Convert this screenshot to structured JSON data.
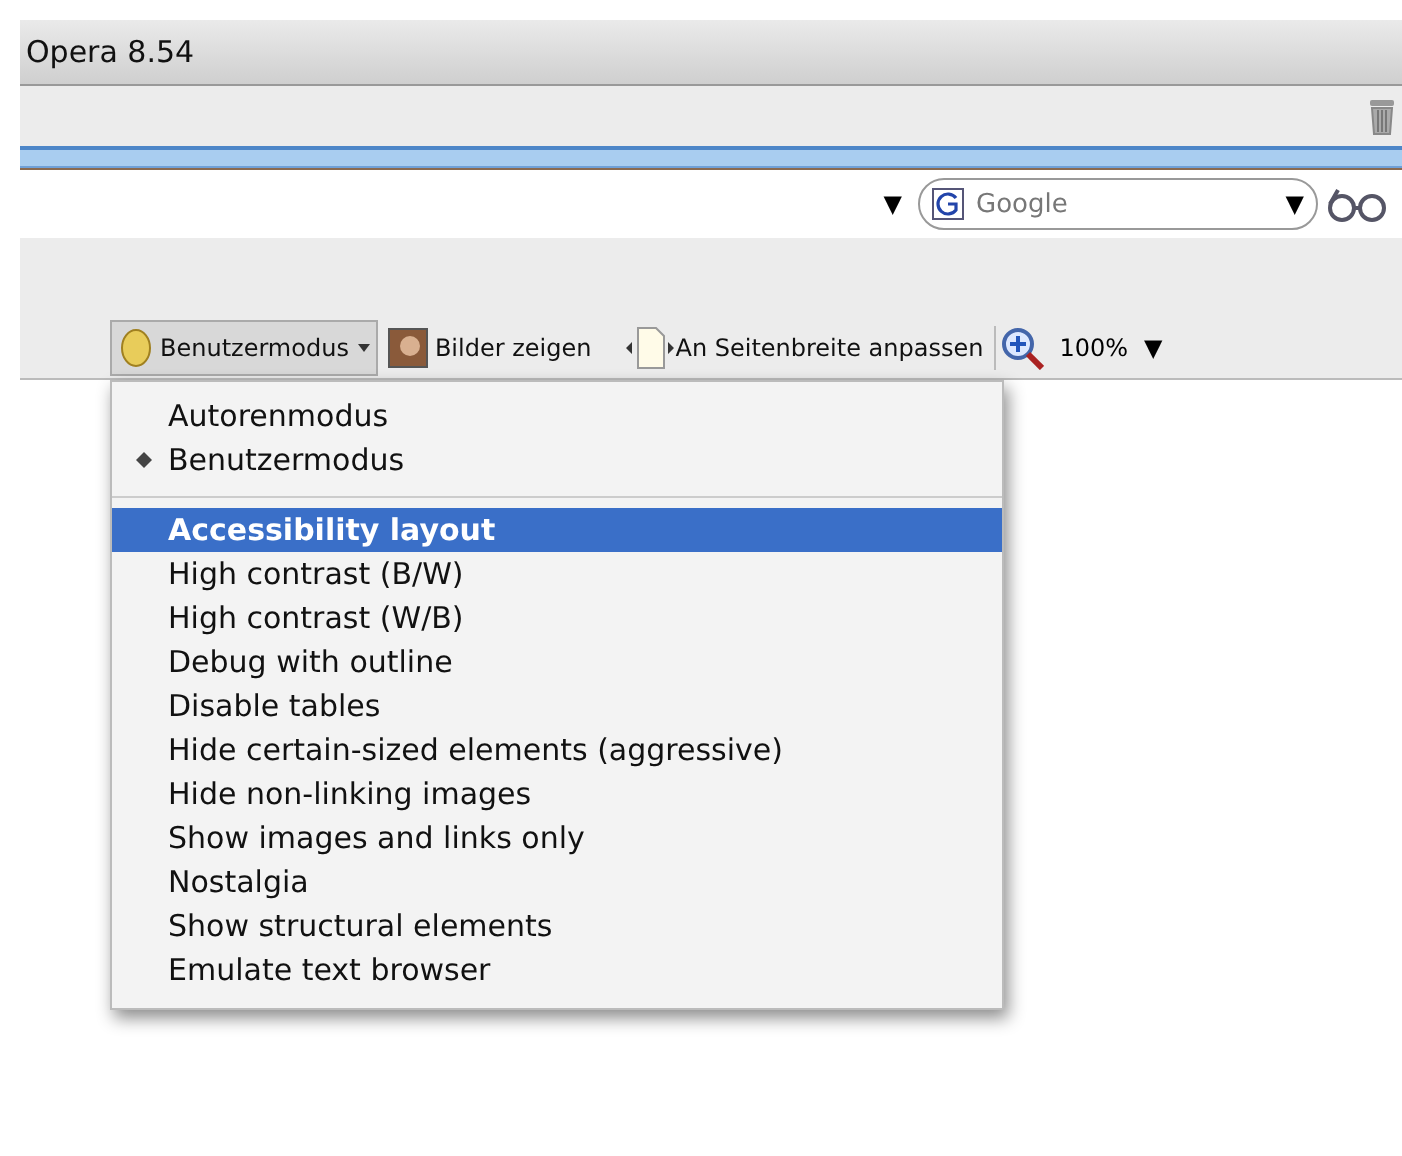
{
  "window": {
    "title": "Opera 8.54"
  },
  "address_bar": {
    "dropdown": "▼"
  },
  "search": {
    "placeholder": "Google",
    "dropdown": "▼"
  },
  "view_toolbar": {
    "mode_button": "Benutzermodus",
    "images_button": "Bilder zeigen",
    "fit_button": "An Seitenbreite anpassen",
    "zoom": "100%",
    "zoom_dropdown": "▼"
  },
  "menu": {
    "sections": [
      [
        {
          "label": "Autorenmodus",
          "checked": false,
          "selected": false
        },
        {
          "label": "Benutzermodus",
          "checked": true,
          "selected": false
        }
      ],
      [
        {
          "label": "Accessibility layout",
          "checked": false,
          "selected": true
        },
        {
          "label": "High contrast (B/W)",
          "checked": false,
          "selected": false
        },
        {
          "label": "High contrast (W/B)",
          "checked": false,
          "selected": false
        },
        {
          "label": "Debug with outline",
          "checked": false,
          "selected": false
        },
        {
          "label": "Disable tables",
          "checked": false,
          "selected": false
        },
        {
          "label": "Hide certain-sized elements (aggressive)",
          "checked": false,
          "selected": false
        },
        {
          "label": "Hide non-linking images",
          "checked": false,
          "selected": false
        },
        {
          "label": "Show images and links only",
          "checked": false,
          "selected": false
        },
        {
          "label": "Nostalgia",
          "checked": false,
          "selected": false
        },
        {
          "label": "Show structural elements",
          "checked": false,
          "selected": false
        },
        {
          "label": "Emulate text browser",
          "checked": false,
          "selected": false
        }
      ]
    ]
  }
}
